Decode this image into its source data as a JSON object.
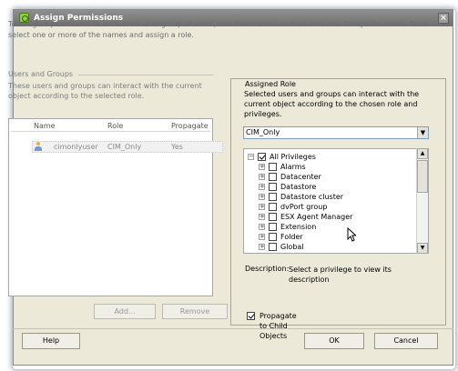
{
  "window": {
    "title": "Assign Permissions",
    "close_label": "×"
  },
  "intro_text": "To assign a permission to an individual or group of users, add their names to the Users and Groups list below. Then select one or more of the names and assign a role.",
  "users_groups": {
    "label": "Users and Groups",
    "description": "These users and groups can interact with the current object according to the selected role.",
    "columns": [
      "Name",
      "Role",
      "Propagate"
    ],
    "rows": [
      {
        "name": "cimonlyuser",
        "role": "CIM_Only",
        "propagate": "Yes"
      }
    ],
    "add_label": "Add...",
    "remove_label": "Remove"
  },
  "assigned_role": {
    "label": "Assigned Role",
    "description": "Selected users and groups can interact with the current object according to the chosen role and privileges.",
    "selected_role": "CIM_Only",
    "privileges": [
      {
        "label": "All Privileges",
        "checked": true,
        "expand": "−"
      },
      {
        "label": "Alarms",
        "checked": false,
        "expand": "+"
      },
      {
        "label": "Datacenter",
        "checked": false,
        "expand": "+"
      },
      {
        "label": "Datastore",
        "checked": false,
        "expand": "+"
      },
      {
        "label": "Datastore cluster",
        "checked": false,
        "expand": "+"
      },
      {
        "label": "dvPort group",
        "checked": false,
        "expand": "+"
      },
      {
        "label": "ESX Agent Manager",
        "checked": false,
        "expand": "+"
      },
      {
        "label": "Extension",
        "checked": false,
        "expand": "+"
      },
      {
        "label": "Folder",
        "checked": false,
        "expand": "+"
      },
      {
        "label": "Global",
        "checked": false,
        "expand": "+"
      }
    ],
    "description_label": "Description:",
    "description_value": "Select a privilege to view its description",
    "propagate_label": "Propagate to Child Objects",
    "propagate_checked": true
  },
  "footer": {
    "help_label": "Help",
    "ok_label": "OK",
    "cancel_label": "Cancel"
  },
  "colors": {
    "dialog_bg": "#ece9d8",
    "titlebar": "#7a7a7a",
    "disabled_text": "#8a8a8a"
  }
}
